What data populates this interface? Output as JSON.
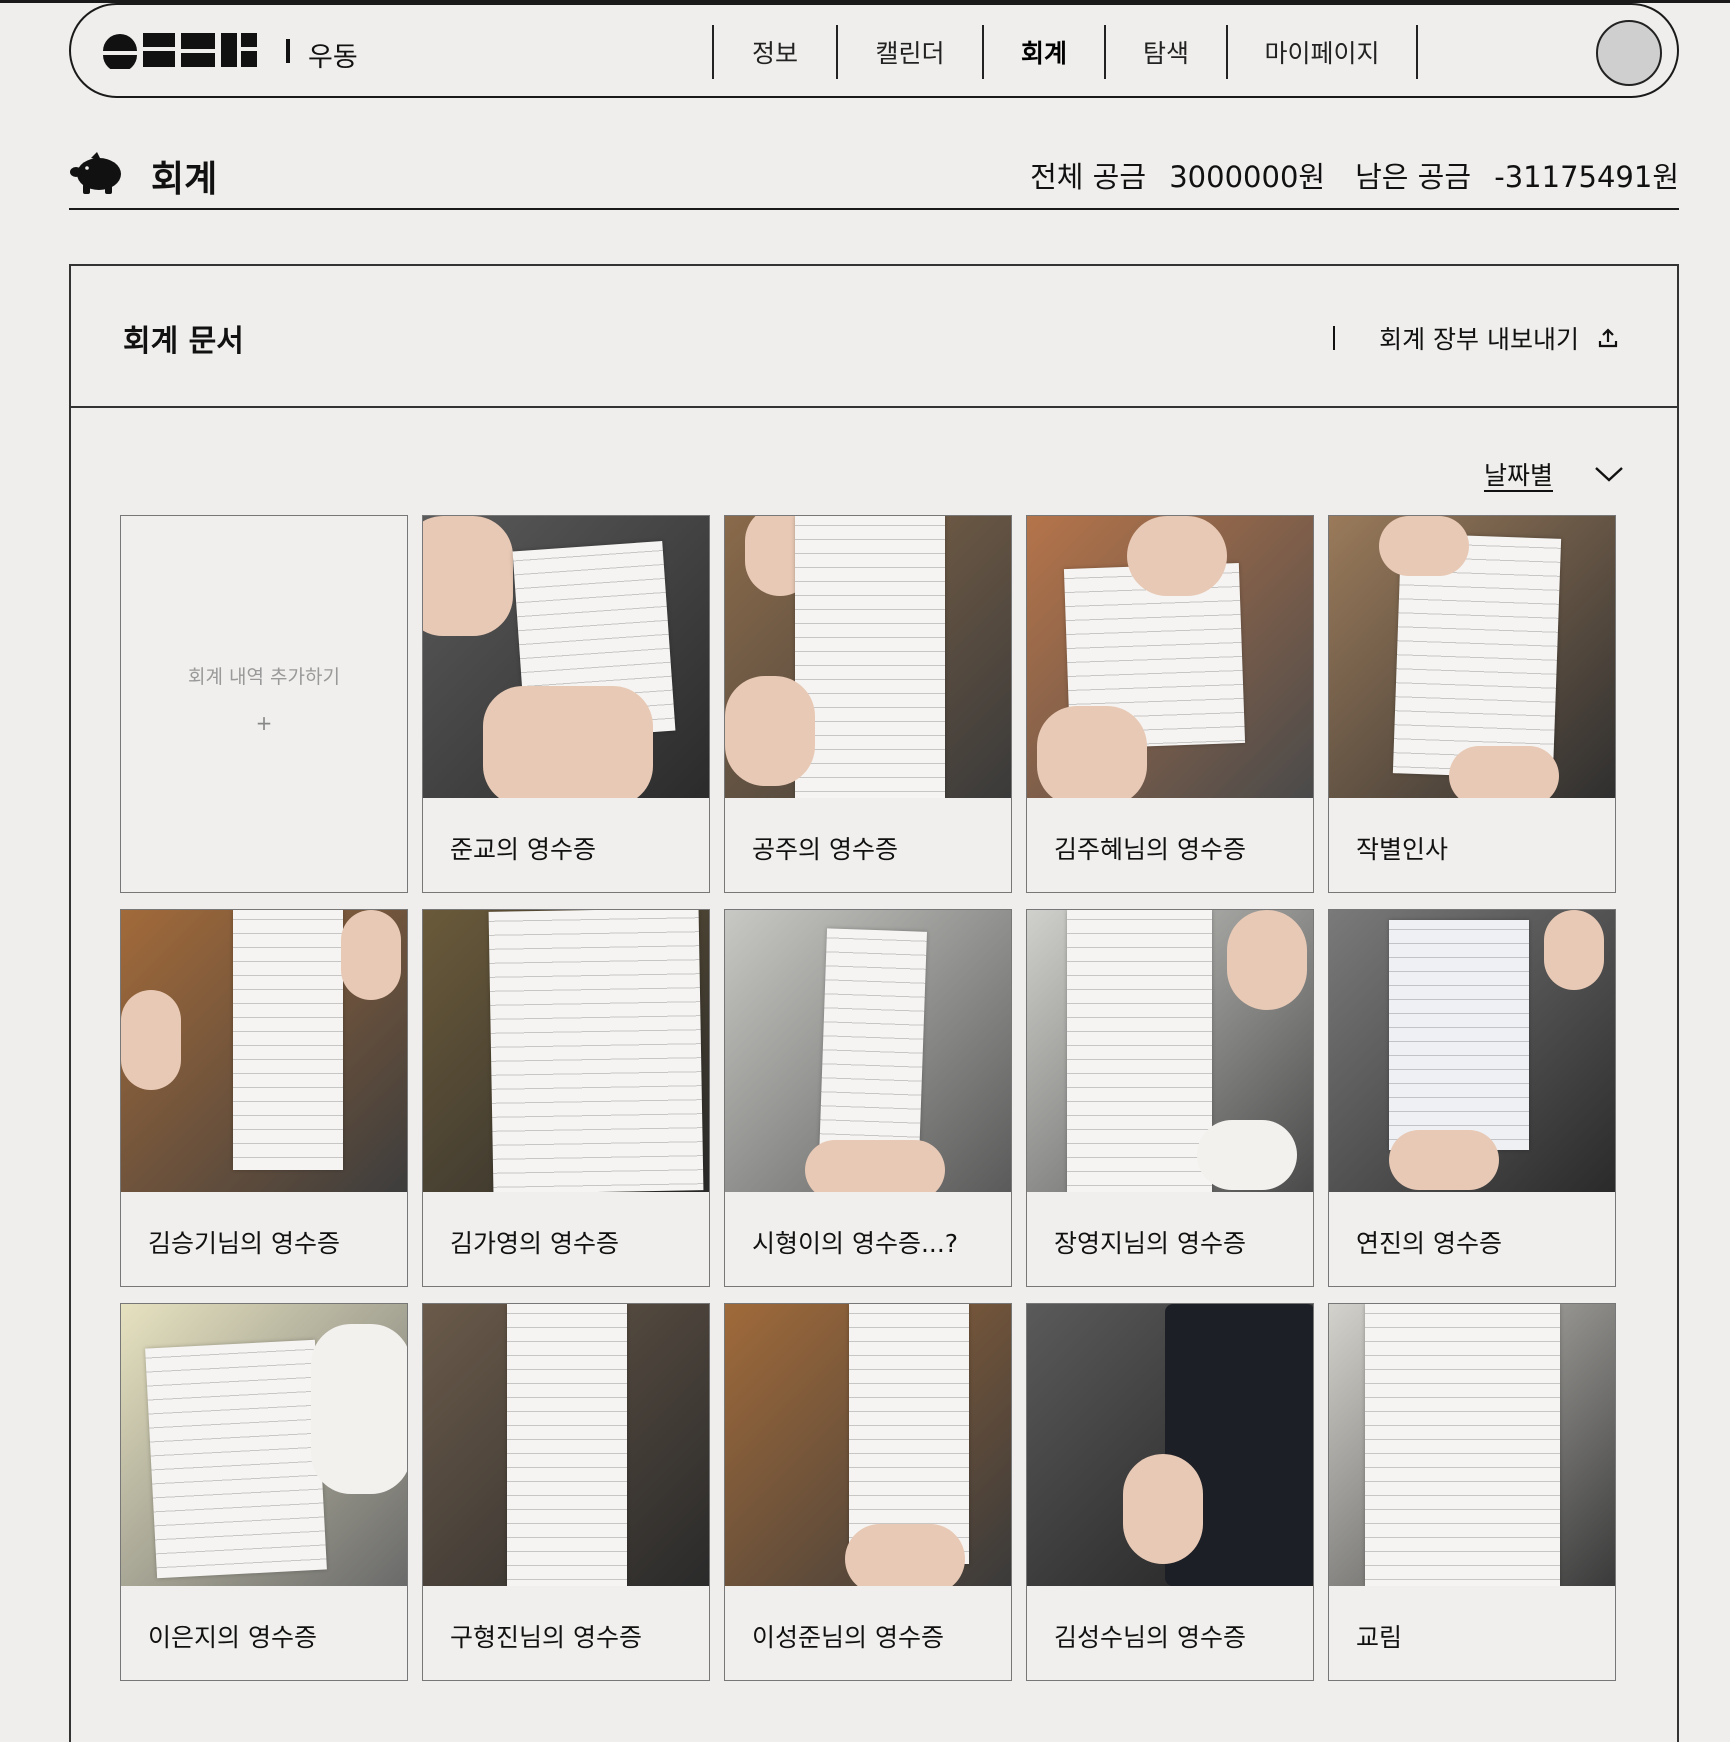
{
  "nav": {
    "club_name": "우동",
    "menu": [
      "정보",
      "캘린더",
      "회계",
      "탐색",
      "마이페이지"
    ],
    "active": "회계"
  },
  "header": {
    "title": "회계",
    "total_label": "전체 공금",
    "total_value": "3000000원",
    "remain_label": "남은 공금",
    "remain_value": "-31175491원"
  },
  "panel": {
    "title": "회계 문서",
    "export_label": "회계 장부 내보내기",
    "sort_label": "날짜별",
    "add_label": "회계 내역 추가하기",
    "add_plus": "+"
  },
  "receipts": [
    {
      "caption": "준교의 영수증"
    },
    {
      "caption": "공주의 영수증"
    },
    {
      "caption": "김주혜님의 영수증"
    },
    {
      "caption": "작별인사"
    },
    {
      "caption": "김승기님의 영수증"
    },
    {
      "caption": "김가영의 영수증"
    },
    {
      "caption": "시형이의 영수증...?"
    },
    {
      "caption": "장영지님의 영수증"
    },
    {
      "caption": "연진의 영수증"
    },
    {
      "caption": "이은지의 영수증"
    },
    {
      "caption": "구형진님의 영수증"
    },
    {
      "caption": "이성준님의 영수증"
    },
    {
      "caption": "김성수님의 영수증"
    },
    {
      "caption": "교림"
    }
  ]
}
